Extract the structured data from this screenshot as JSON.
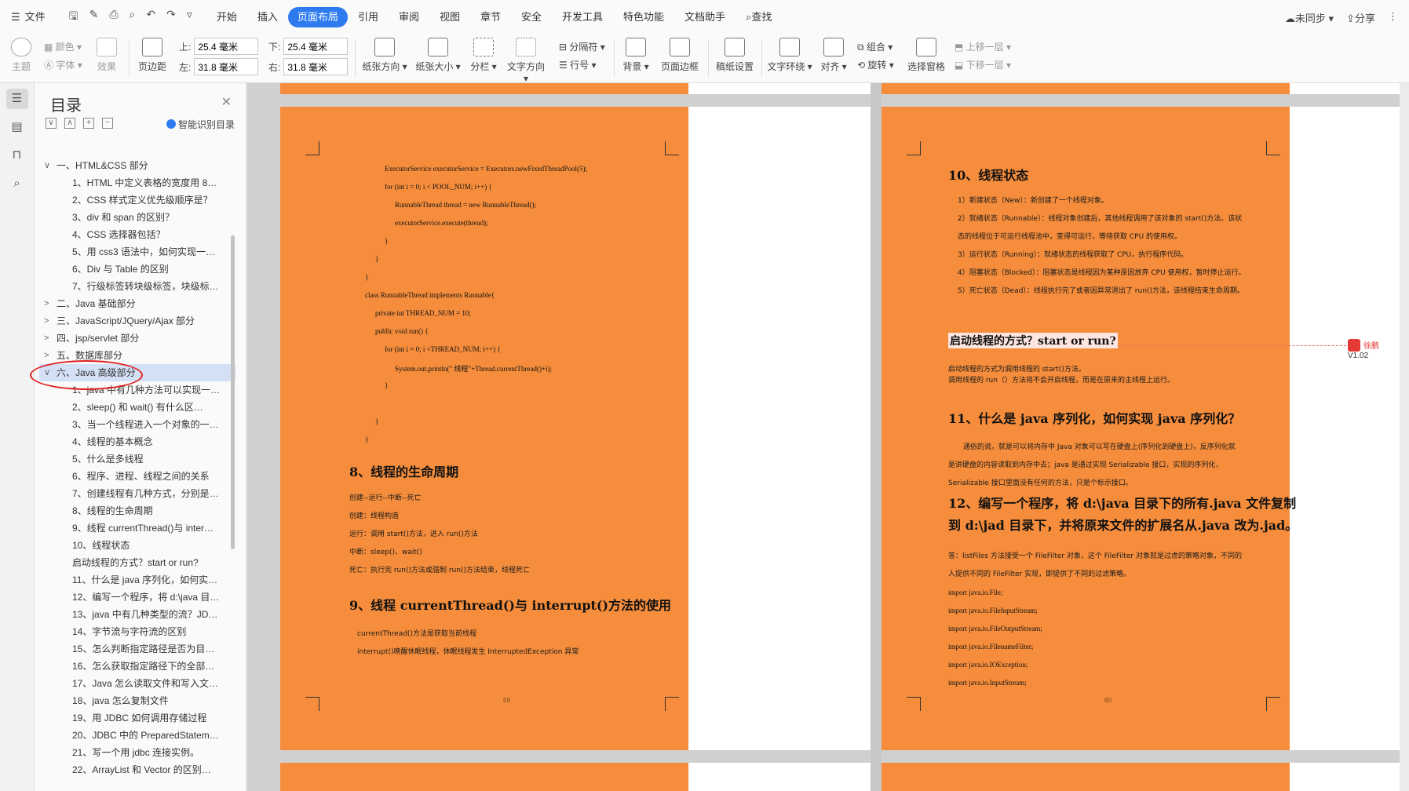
{
  "menubar": {
    "file": "文件",
    "tabs": [
      "开始",
      "插入",
      "页面布局",
      "引用",
      "审阅",
      "视图",
      "章节",
      "安全",
      "开发工具",
      "特色功能",
      "文档助手"
    ],
    "active_tab": "页面布局",
    "search": "查找",
    "sync": "未同步",
    "share": "分享"
  },
  "ribbon": {
    "theme": "主题",
    "colors": "颜色",
    "fonts": "字体",
    "effects": "效果",
    "margins": "页边距",
    "top_label": "上:",
    "top_value": "25.4 毫米",
    "bottom_label": "下:",
    "bottom_value": "25.4 毫米",
    "left_label": "左:",
    "left_value": "31.8 毫米",
    "right_label": "右:",
    "right_value": "31.8 毫米",
    "orientation": "纸张方向",
    "size": "纸张大小",
    "columns": "分栏",
    "text_direction": "文字方向",
    "breaks": "分隔符",
    "line_numbers": "行号",
    "background": "背景",
    "page_border": "页面边框",
    "manuscript": "稿纸设置",
    "wrap": "文字环绕",
    "align": "对齐",
    "group": "组合",
    "rotate": "旋转",
    "selection_pane": "选择窗格",
    "bring_forward": "上移一层",
    "send_backward": "下移一层"
  },
  "toc": {
    "title": "目录",
    "smart": "智能识别目录",
    "items": [
      {
        "level": 1,
        "caret": "∨",
        "text": "一、HTML&CSS 部分"
      },
      {
        "level": 2,
        "text": "1、HTML 中定义表格的宽度用 8…"
      },
      {
        "level": 2,
        "text": "2、CSS 样式定义优先级顺序是？"
      },
      {
        "level": 2,
        "text": "3、div 和 span 的区别？"
      },
      {
        "level": 2,
        "text": "4、CSS 选择器包括？"
      },
      {
        "level": 2,
        "text": "5、用 css3 语法中，如何实现一…"
      },
      {
        "level": 2,
        "text": "6、Div 与 Table 的区别"
      },
      {
        "level": 2,
        "text": "7、行级标签转块级标签，块级标…"
      },
      {
        "level": 1,
        "caret": ">",
        "text": "二、Java 基础部分"
      },
      {
        "level": 1,
        "caret": ">",
        "text": "三、JavaScript/JQuery/Ajax 部分"
      },
      {
        "level": 1,
        "caret": ">",
        "text": "四、jsp/servlet 部分"
      },
      {
        "level": 1,
        "caret": ">",
        "text": "五、数据库部分"
      },
      {
        "level": 1,
        "caret": "∨",
        "text": "六、Java 高级部分",
        "highlight": true
      },
      {
        "level": 2,
        "text": "1、java 中有几种方法可以实现一…"
      },
      {
        "level": 2,
        "text": "2、sleep() 和 wait() 有什么区…"
      },
      {
        "level": 2,
        "text": "3、当一个线程进入一个对象的一…"
      },
      {
        "level": 2,
        "text": "4、线程的基本概念"
      },
      {
        "level": 2,
        "text": "5、什么是多线程"
      },
      {
        "level": 2,
        "text": "6、程序、进程、线程之间的关系"
      },
      {
        "level": 2,
        "text": "7、创建线程有几种方式，分别是…"
      },
      {
        "level": 2,
        "text": "8、线程的生命周期"
      },
      {
        "level": 2,
        "text": "9、线程 currentThread()与 inter…"
      },
      {
        "level": 2,
        "text": "10、线程状态"
      },
      {
        "level": 3,
        "text": "启动线程的方式？start or run?"
      },
      {
        "level": 2,
        "text": "11、什么是 java 序列化，如何实…"
      },
      {
        "level": 2,
        "text": "12、编写一个程序，将 d:\\java 目…"
      },
      {
        "level": 2,
        "text": "13、java 中有几种类型的流？JD…"
      },
      {
        "level": 2,
        "text": "14、字节流与字符流的区别"
      },
      {
        "level": 2,
        "text": "15、怎么判断指定路径是否为目…"
      },
      {
        "level": 2,
        "text": "16、怎么获取指定路径下的全部…"
      },
      {
        "level": 2,
        "text": "17、Java 怎么读取文件和写入文…"
      },
      {
        "level": 2,
        "text": "18、java 怎么复制文件"
      },
      {
        "level": 2,
        "text": "19、用 JDBC 如何调用存储过程"
      },
      {
        "level": 2,
        "text": "20、JDBC 中的 PreparedStatem…"
      },
      {
        "level": 2,
        "text": "21、写一个用 jdbc 连接实例。"
      },
      {
        "level": 2,
        "text": "22、ArrayList 和 Vector 的区别…"
      }
    ]
  },
  "page59": {
    "code": [
      "ExecutorService executorService = Executors.newFixedThreadPool(5);",
      "for (int i = 0; i < POOL_NUM; i++) {",
      "RunnableThread thread = new RunnableThread();",
      "executorService.execute(thread);",
      "}",
      "}",
      "}",
      "class RunnableThread implements   Runnable{",
      "private     int THREAD_NUM = 10;",
      "public void run() {",
      "for (int i = 0; i <THREAD_NUM; i++) {",
      "System.out.println(\" 线程\"+Thread.currentThread()+i);",
      "}",
      "}",
      "}"
    ],
    "h8": "8、线程的生命周期",
    "lifecycle": [
      "创建--运行--中断--死亡",
      "创建：线程构造",
      "运行：调用 start()方法，进入 run()方法",
      "中断：sleep()、wait()",
      "死亡：执行完 run()方法或强制 run()方法结束，线程死亡"
    ],
    "h9": "9、线程 currentThread()与 interrupt()方法的使用",
    "methods": [
      "currentThread()方法是获取当前线程",
      "interrupt()唤醒休眠线程，休眠线程发生 InterruptedException 异常"
    ],
    "page_number": "59"
  },
  "page60": {
    "h10": "10、线程状态",
    "states": [
      "1）新建状态（New）：新创建了一个线程对象。",
      "2）就绪状态（Runnable）：线程对象创建后，其他线程调用了该对象的 start()方法。该状",
      "态的线程位于可运行线程池中，变得可运行，等待获取 CPU 的使用权。",
      "3）运行状态（Running）：就绪状态的线程获取了 CPU，执行程序代码。",
      "4）阻塞状态（Blocked）：阻塞状态是线程因为某种原因放弃 CPU 使用权，暂时停止运行。",
      "5）死亡状态（Dead）：线程执行完了或者因异常退出了 run()方法，该线程结束生命周期。"
    ],
    "start_head": "启动线程的方式？start or run?",
    "start_text": [
      "启动线程的方式为调用线程的 start()方法。",
      "调用线程的 run（）方法将不会开启线程，而是在原来的主线程上运行。"
    ],
    "h11": "11、什么是 java 序列化，如何实现 java 序列化？",
    "serial": [
      "通俗的说，就是可以将内存中 Java 对象可以写在硬盘上(序列化到硬盘上)，反序列化就",
      "是讲硬盘的内容读取到内存中去；java 是通过实现 Serializable 接口，实现的序列化，",
      "Serializable 接口里面没有任何的方法，只是个标示接口。"
    ],
    "h12a": "12、编写一个程序，将 d:\\java 目录下的所有.java 文件复制",
    "h12b": "到 d:\\jad 目录下，并将原来文件的扩展名从.java 改为.jad。",
    "answer": [
      "答：listFiles 方法接受一个 FileFilter 对象，这个 FileFilter 对象就是过虑的策略对象，不同的",
      "人提供不同的 FileFilter 实现，即提供了不同的过滤策略。"
    ],
    "imports": [
      "import java.io.File;",
      "import java.io.FileInputStream;",
      "import java.io.FileOutputStream;",
      "import java.io.FilenameFilter;",
      "import java.io.IOException;",
      "import java.io.InputStream;"
    ],
    "page_number": "60"
  },
  "comment": {
    "author": "徐鹏",
    "version": "V1.02"
  },
  "colors": {
    "page": "#f58d3c",
    "accent": "#2e7bf0",
    "circle": "#e02020"
  }
}
